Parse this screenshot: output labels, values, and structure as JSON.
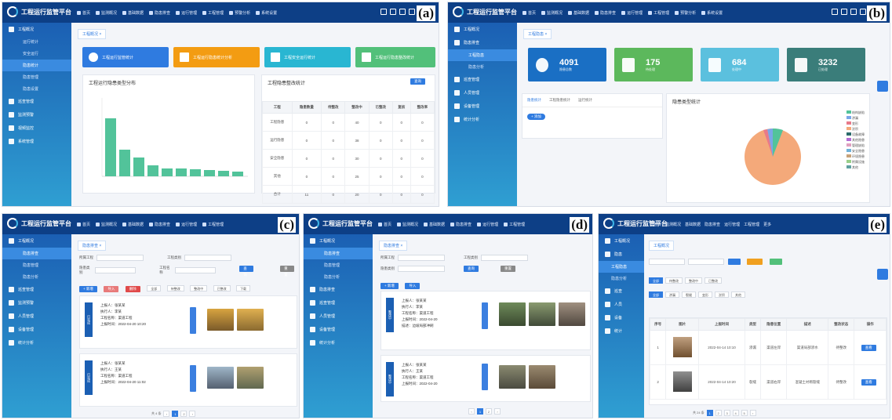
{
  "panels": {
    "a": {
      "label": "(a)"
    },
    "b": {
      "label": "(b)"
    },
    "c": {
      "label": "(c)"
    },
    "d": {
      "label": "(d)"
    },
    "e": {
      "label": "(e)"
    }
  },
  "app": {
    "title": "工程运行监管平台"
  },
  "nav_items": [
    "首页",
    "监测概况",
    "基础数据",
    "隐患排查",
    "运行管理",
    "工程管理",
    "预警分析",
    "系统设置",
    "更多"
  ],
  "a": {
    "quick": [
      "工程运行监管统计",
      "工程运行隐患统计分析",
      "工程安全运行统计",
      "工程运行隐患整改统计"
    ],
    "chart_card_title": "工程运行隐患类型分布",
    "table_card_title": "工程隐患整改统计",
    "table_headers": [
      "工程",
      "隐患数量",
      "待整改",
      "整改中",
      "已整改",
      "复核",
      "整改率"
    ],
    "table_rows": [
      [
        "工程隐患",
        "0",
        "0",
        "40",
        "0",
        "0",
        "0"
      ],
      [
        "运行隐患",
        "0",
        "0",
        "38",
        "0",
        "0",
        "0"
      ],
      [
        "安全隐患",
        "0",
        "0",
        "30",
        "0",
        "0",
        "0"
      ],
      [
        "其他",
        "0",
        "0",
        "25",
        "0",
        "0",
        "0"
      ],
      [
        "合计",
        "11",
        "0",
        "20",
        "0",
        "0",
        "0"
      ]
    ],
    "search_label": "查询"
  },
  "b": {
    "stats": [
      {
        "value": "4091",
        "label": "隐患总数",
        "color": "#1a6fc4"
      },
      {
        "value": "175",
        "label": "待处理",
        "color": "#5cb85c"
      },
      {
        "value": "684",
        "label": "处理中",
        "color": "#5bc0de"
      },
      {
        "value": "3232",
        "label": "已处理",
        "color": "#3a7d7a"
      }
    ],
    "tabs": [
      "隐患统计",
      "工程隐患统计",
      "运行统计"
    ],
    "add_label": "+ 添加",
    "pie_title": "隐患类型统计",
    "legend": [
      "结构缺陷",
      "渗漏",
      "变形",
      "淤积",
      "设备故障",
      "其他隐患",
      "管理缺陷",
      "安全隐患",
      "环境隐患",
      "附属设施",
      "其他"
    ]
  },
  "c": {
    "fields": [
      "所属工程",
      "工程类别",
      "隐患类别",
      "工程名称"
    ],
    "buttons": [
      "+ 新增",
      "导入",
      "删除",
      "查询",
      "重置"
    ],
    "filters": [
      "全部",
      "待整改",
      "整改中",
      "已整改",
      "下载"
    ],
    "head": "隐患",
    "records": [
      {
        "stamp": "已完成",
        "lines": [
          "上报人：张某某",
          "执行人：李某",
          "工程名称：渠道工程",
          "上报时间：2022-04-20 10:20"
        ]
      },
      {
        "stamp": "已完成",
        "lines": [
          "上报人：张某某",
          "执行人：王某",
          "工程名称：渠道工程",
          "上报时间：2022-04-20 11:02"
        ]
      }
    ],
    "page_total": "共 4 条"
  },
  "d": {
    "fields": [
      "所属工程",
      "工程类别",
      "隐患类别",
      "工程名称"
    ],
    "buttons": [
      "+ 新增",
      "导入",
      "查询",
      "重置"
    ],
    "records": [
      {
        "stamp": "整改中",
        "lines": [
          "上报人：张某某",
          "执行人：李某",
          "工程名称：渠道工程",
          "上报时间：2022-04-20",
          "描述：边坡局部冲刷"
        ]
      },
      {
        "stamp": "整改中",
        "lines": [
          "上报人：张某某",
          "执行人：王某",
          "工程名称：渠道工程",
          "上报时间：2022-04-20"
        ]
      }
    ]
  },
  "e": {
    "crumb": "工程概况",
    "table_headers": [
      "序号",
      "图片",
      "上报时间",
      "类型",
      "隐患位置",
      "描述",
      "整改状态",
      "操作"
    ],
    "rows": [
      {
        "time": "2022-04-14 10:10",
        "type": "渗漏",
        "loc": "渠道左岸",
        "desc": "渠道局部渗水",
        "status": "待整改",
        "op": "查看"
      },
      {
        "time": "2022-04-14 10:20",
        "type": "裂缝",
        "loc": "渠道右岸",
        "desc": "混凝土衬砌裂缝",
        "status": "待整改",
        "op": "查看"
      }
    ],
    "page_total": "共 24 条"
  }
}
